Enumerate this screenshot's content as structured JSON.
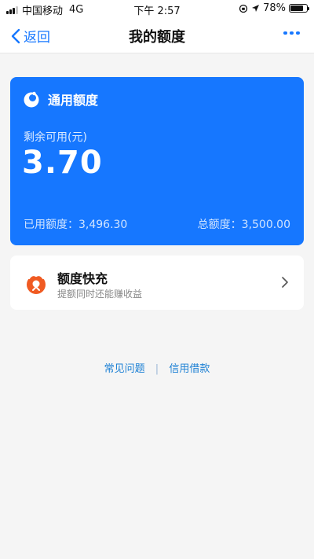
{
  "status_bar": {
    "carrier": "中国移动",
    "network": "4G",
    "time": "下午 2:57",
    "battery": "78%",
    "battery_level": 0.78
  },
  "nav": {
    "back_label": "返回",
    "title": "我的额度"
  },
  "credit_card": {
    "title": "通用额度",
    "available_label": "剩余可用(元)",
    "available_amount": "3.70",
    "used_text": "已用额度：3,496.30",
    "total_text": "总额度：3,500.00",
    "color": "#1677ff"
  },
  "boost": {
    "title": "额度快充",
    "subtitle": "提额同时还能赚收益",
    "icon": "boost-logo-icon",
    "icon_color": "#f05a22"
  },
  "footer": {
    "faq": "常见问题",
    "separator": "|",
    "credit_loan": "信用借款"
  }
}
